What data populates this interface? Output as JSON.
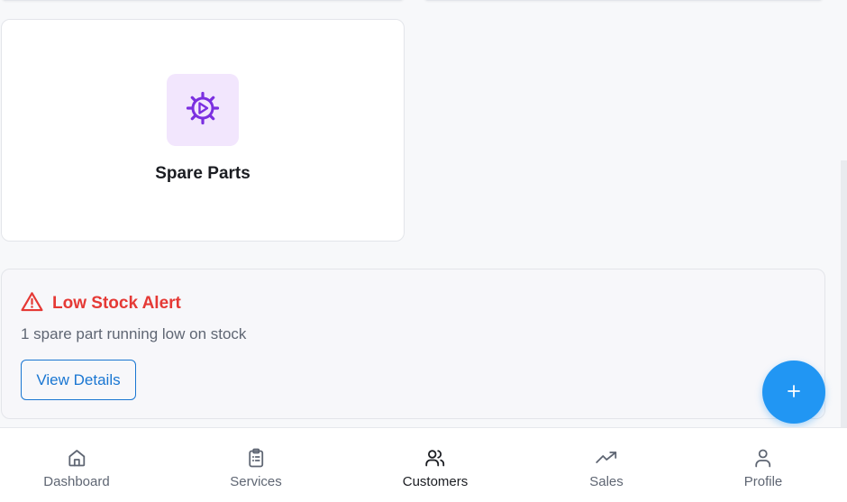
{
  "category": {
    "label": "Spare Parts",
    "icon": "gear-icon",
    "icon_color": "#7b2fe0",
    "icon_bg": "#f2e6fd"
  },
  "alert": {
    "title": "Low Stock Alert",
    "description": "1 spare part running low on stock",
    "button_label": "View Details",
    "icon": "warning-triangle-icon",
    "color": "#e53935"
  },
  "fab": {
    "label": "+",
    "icon": "plus-icon",
    "color": "#2196f3"
  },
  "nav": {
    "active": "Customers",
    "items": [
      {
        "label": "Dashboard",
        "icon": "home-icon"
      },
      {
        "label": "Services",
        "icon": "clipboard-list-icon"
      },
      {
        "label": "Customers",
        "icon": "users-icon"
      },
      {
        "label": "Sales",
        "icon": "trending-up-icon"
      },
      {
        "label": "Profile",
        "icon": "user-icon"
      }
    ]
  }
}
